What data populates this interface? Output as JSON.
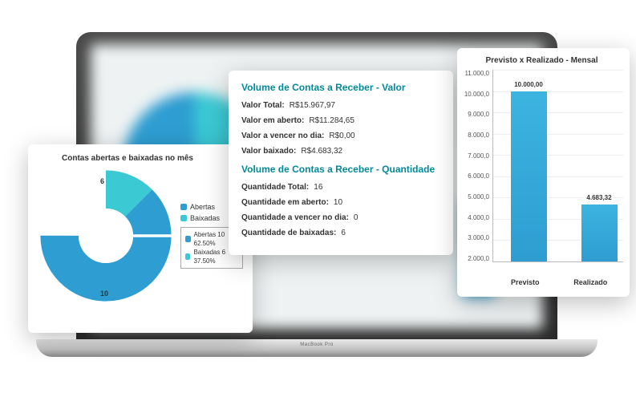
{
  "laptop_logo": "MacBook Pro",
  "pie_card": {
    "title": "Contas abertas e baixadas no mês",
    "legend": {
      "abertas": "Abertas",
      "baixadas": "Baixadas"
    },
    "box": {
      "abertas_text": "Abertas  10  62.50%",
      "baixadas_text": "Baixadas  6  37.50%"
    },
    "top_label": "6",
    "bottom_label": "10"
  },
  "info_card": {
    "valor_title": "Volume de Contas a Receber - Valor",
    "valor_rows": [
      {
        "k": "Valor Total:",
        "v": "R$15.967,97"
      },
      {
        "k": "Valor em aberto:",
        "v": "R$11.284,65"
      },
      {
        "k": "Valor a vencer no dia:",
        "v": "R$0,00"
      },
      {
        "k": "Valor baixado:",
        "v": "R$4.683,32"
      }
    ],
    "qtd_title": "Volume de Contas a Receber - Quantidade",
    "qtd_rows": [
      {
        "k": "Quantidade Total:",
        "v": "16"
      },
      {
        "k": "Quantidade em aberto:",
        "v": "10"
      },
      {
        "k": "Quantidade a vencer no dia:",
        "v": "0"
      },
      {
        "k": "Quantidade de baixadas:",
        "v": "6"
      }
    ]
  },
  "bar_card": {
    "title": "Previsto x Realizado - Mensal",
    "y_ticks": [
      "11.000,0",
      "10.000,0",
      "9.000,0",
      "8.000,0",
      "7.000,0",
      "6.000,0",
      "5.000,0",
      "4.000,0",
      "3.000,0",
      "2.000,0"
    ],
    "previsto_label": "Previsto",
    "realizado_label": "Realizado",
    "previsto_data_label": "10.000,00",
    "realizado_data_label": "4.683,32"
  },
  "chart_data": [
    {
      "type": "pie",
      "title": "Contas abertas e baixadas no mês",
      "series": [
        {
          "name": "Abertas",
          "value": 10,
          "percent": 62.5,
          "color": "#2e9dd1"
        },
        {
          "name": "Baixadas",
          "value": 6,
          "percent": 37.5,
          "color": "#3bc9d4"
        }
      ],
      "donut": true
    },
    {
      "type": "bar",
      "title": "Previsto x Realizado - Mensal",
      "categories": [
        "Previsto",
        "Realizado"
      ],
      "values": [
        10000.0,
        4683.32
      ],
      "ylim": [
        2000,
        11000
      ],
      "ylabel": "",
      "xlabel": ""
    }
  ],
  "colors": {
    "teal_header": "#008a9a",
    "bar_blue": "#2e9dd1",
    "cyan": "#3bc9d4"
  }
}
